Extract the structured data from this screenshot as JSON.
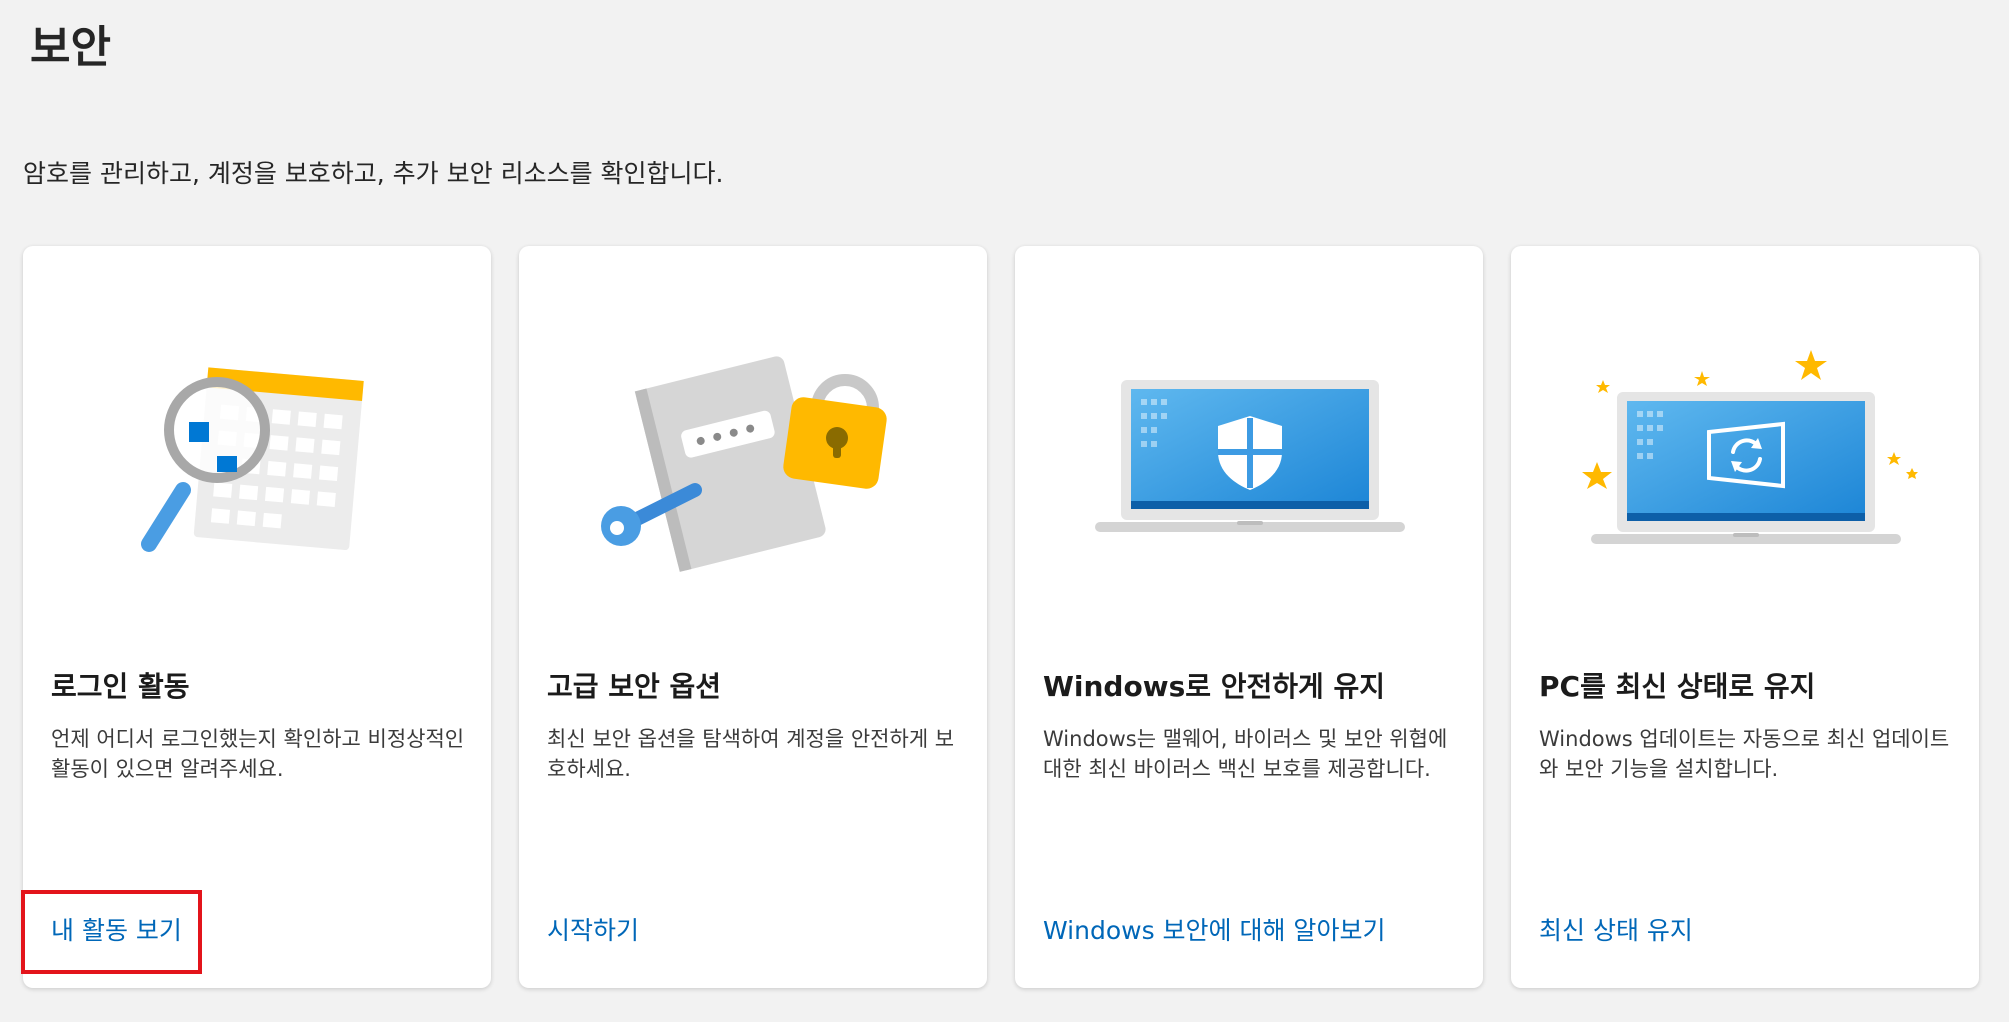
{
  "page": {
    "title": "보안",
    "subtitle": "암호를 관리하고, 계정을 보호하고, 추가 보안 리소스를 확인합니다."
  },
  "cards": [
    {
      "illustration": "magnifier-calendar-icon",
      "title": "로그인 활동",
      "description": "언제 어디서 로그인했는지 확인하고 비정상적인 활동이 있으면 알려주세요.",
      "link": "내 활동 보기"
    },
    {
      "illustration": "password-key-lock-icon",
      "title": "고급 보안 옵션",
      "description": "최신 보안 옵션을 탐색하여 계정을 안전하게 보호하세요.",
      "link": "시작하기"
    },
    {
      "illustration": "laptop-shield-icon",
      "title": "Windows로 안전하게 유지",
      "description": "Windows는 맬웨어, 바이러스 및 보안 위협에 대한 최신 바이러스 백신 보호를 제공합니다.",
      "link": "Windows 보안에 대해 알아보기"
    },
    {
      "illustration": "laptop-update-icon",
      "title": "PC를 최신 상태로 유지",
      "description": "Windows 업데이트는 자동으로 최신 업데이트와 보안 기능을 설치합니다.",
      "link": "최신 상태 유지"
    }
  ],
  "colors": {
    "background": "#f2f2f2",
    "card": "#ffffff",
    "link": "#0067b8",
    "highlight": "#e3141b",
    "accent_yellow": "#ffb900",
    "accent_blue": "#0078d4"
  }
}
